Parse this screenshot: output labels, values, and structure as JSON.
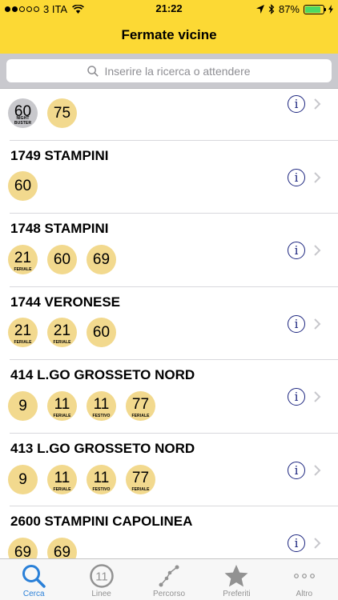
{
  "status": {
    "carrier": "3 ITA",
    "time": "21:22",
    "battery": "87%",
    "battery_level": 0.87
  },
  "header": {
    "title": "Fermate vicine"
  },
  "search": {
    "placeholder": "Inserire la ricerca o attendere"
  },
  "stops": [
    {
      "name": "",
      "lines": [
        {
          "num": "60",
          "sub": "NIGHT BUSTER",
          "style": "gray"
        },
        {
          "num": "75",
          "sub": ""
        }
      ]
    },
    {
      "name": "1749 STAMPINI",
      "lines": [
        {
          "num": "60",
          "sub": ""
        }
      ]
    },
    {
      "name": "1748 STAMPINI",
      "lines": [
        {
          "num": "21",
          "sub": "FERIALE"
        },
        {
          "num": "60",
          "sub": ""
        },
        {
          "num": "69",
          "sub": ""
        }
      ]
    },
    {
      "name": "1744 VERONESE",
      "lines": [
        {
          "num": "21",
          "sub": "FERIALE"
        },
        {
          "num": "21",
          "sub": "FERIALE"
        },
        {
          "num": "60",
          "sub": ""
        }
      ]
    },
    {
      "name": "414 L.GO GROSSETO NORD",
      "lines": [
        {
          "num": "9",
          "sub": ""
        },
        {
          "num": "11",
          "sub": "FERIALE"
        },
        {
          "num": "11",
          "sub": "FESTIVO"
        },
        {
          "num": "77",
          "sub": "FERIALE"
        }
      ]
    },
    {
      "name": "413 L.GO GROSSETO NORD",
      "lines": [
        {
          "num": "9",
          "sub": ""
        },
        {
          "num": "11",
          "sub": "FERIALE"
        },
        {
          "num": "11",
          "sub": "FESTIVO"
        },
        {
          "num": "77",
          "sub": "FERIALE"
        }
      ]
    },
    {
      "name": "2600 STAMPINI CAPOLINEA",
      "lines": [
        {
          "num": "69",
          "sub": ""
        },
        {
          "num": "69",
          "sub": ""
        }
      ]
    }
  ],
  "tabs": [
    {
      "label": "Cerca",
      "icon": "search-icon",
      "active": true
    },
    {
      "label": "Linee",
      "icon": "line-number-icon",
      "badge": "11",
      "active": false
    },
    {
      "label": "Percorso",
      "icon": "route-icon",
      "active": false
    },
    {
      "label": "Preferiti",
      "icon": "star-icon",
      "active": false
    },
    {
      "label": "Altro",
      "icon": "more-icon",
      "active": false
    }
  ],
  "colors": {
    "header": "#fcd934",
    "badge": "#f2d98e",
    "badge_night": "#c8c8cc",
    "info": "#1a237e",
    "tab_active": "#2a80d8"
  }
}
